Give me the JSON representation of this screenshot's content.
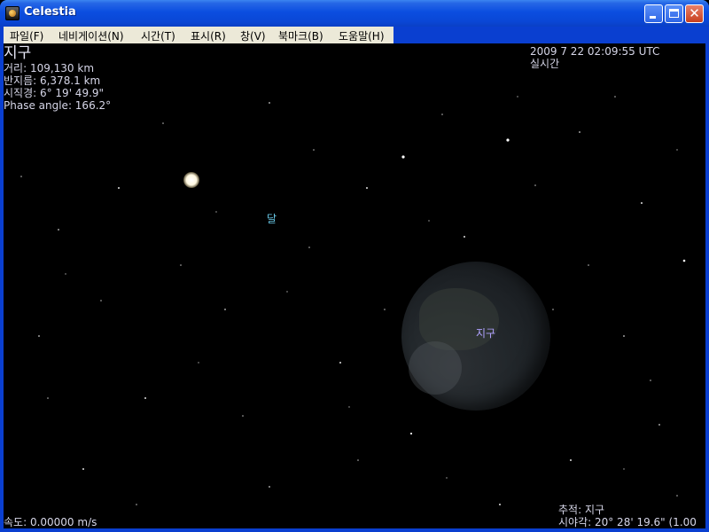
{
  "window": {
    "title": "Celestia"
  },
  "menu": {
    "items": [
      {
        "label": "파일(F)"
      },
      {
        "label": "네비게이션(N)"
      },
      {
        "label": "시간(T)"
      },
      {
        "label": "표시(R)"
      },
      {
        "label": "창(V)"
      },
      {
        "label": "북마크(B)"
      },
      {
        "label": "도움말(H)"
      }
    ]
  },
  "info": {
    "object_name": "지구",
    "distance": "거리: 109,130 km",
    "radius": "반지름: 6,378.1 km",
    "apparent_diameter": "시직경: 6° 19' 49.9\"",
    "phase_angle": "Phase angle: 166.2°"
  },
  "time": {
    "datetime": "2009 7 22 02:09:55 UTC",
    "mode": "실시간"
  },
  "labels": {
    "moon": "달",
    "earth": "지구"
  },
  "status": {
    "speed": "속도: 0.00000 m/s",
    "tracking": "추적: 지구",
    "fov": "시야각: 20° 28' 19.6\" (1.00"
  },
  "colors": {
    "titlebar": "#0b4ee0",
    "menubar": "#ece9d8",
    "hud_text": "#d6d6e8",
    "moon_label": "#69c9e8",
    "earth_label": "#b0a2ff",
    "space": "#000000"
  },
  "icons": {
    "app": "celestia-app-icon",
    "minimize": "minimize-icon",
    "maximize": "maximize-icon",
    "close": "close-icon"
  }
}
